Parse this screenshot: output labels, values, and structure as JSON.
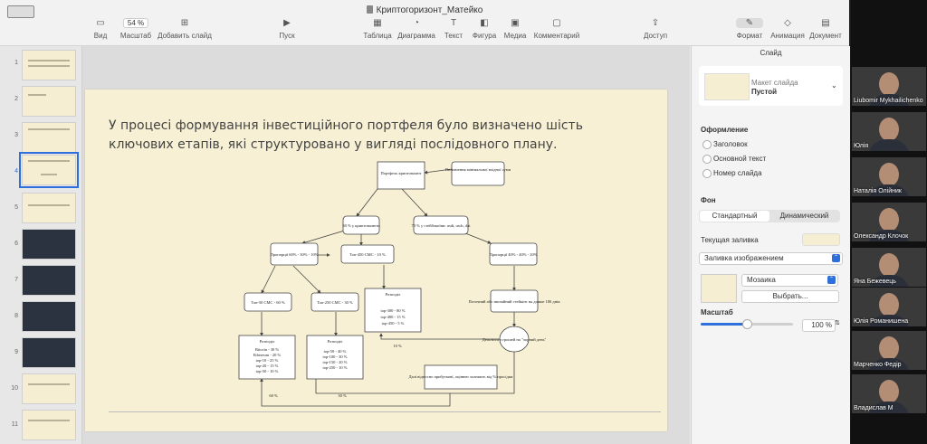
{
  "window": {
    "title": "Криптогоризонт_Матейко"
  },
  "toolbar": {
    "view": "Вид",
    "zoom_value": "54 %",
    "zoom_label": "Масштаб",
    "add_slide": "Добавить слайд",
    "play": "Пуск",
    "table": "Таблица",
    "chart": "Диаграмма",
    "text": "Текст",
    "shape": "Фигура",
    "media": "Медиа",
    "comment": "Комментарий",
    "access": "Доступ",
    "format": "Формат",
    "animation": "Анимация",
    "document": "Документ"
  },
  "sidebar": {
    "numbers": [
      "1",
      "2",
      "3",
      "4",
      "5",
      "6",
      "7",
      "8",
      "9",
      "10",
      "11"
    ],
    "selected": "4"
  },
  "slide": {
    "text": "У процесі формування інвестиційного портфеля було визначено шість ключових етапів, які структуровано у вигляді послідовного плану.",
    "flow": {
      "portfolio": "Портфель криптовалют",
      "min_sum": "Визначення мінімальної вхідної суми",
      "crypto30": "30 % у криптовалюти",
      "stable70": "70 % у стейблкоїни: usdt, usdc, dai",
      "prop_left": "Пропорції 60% - 30% - 10%",
      "prop_right": "Пропорції 40% - 40% - 20%",
      "top450": "Топ-450 CMC - 10 %",
      "top50": "Топ-50 CMC - 60 %",
      "top250": "Топ-250 CMC - 30 %",
      "split_title": "Розподіл",
      "split_top": [
        "top-300 - 80 %",
        "top-400 - 15 %",
        "top-450 - 5 %"
      ],
      "split_left": [
        "Bitcoin - 30 %",
        "Ethereum - 20 %",
        "top-10 - 25 %",
        "top-20 - 15 %",
        "top-50 - 10 %"
      ],
      "split_mid": [
        "top-50 - 40 %",
        "top-100 - 30 %",
        "top-150 - 20 %",
        "top-250 - 10 %"
      ],
      "current_pool": "Поточний або звичайний стейкінг на довше 180 днів",
      "black_day": "Депозити з грошей на \"чорний день\"",
      "further": "Далі відносно прибутковї, оцінюю залежить від % просідки",
      "pct10": "10 %",
      "pct60": "60 %",
      "pct30": "30 %"
    }
  },
  "inspector": {
    "tab": "Слайд",
    "layout_label": "Макет слайда",
    "layout_value": "Пустой",
    "design_title": "Оформление",
    "opt_title": "Заголовок",
    "opt_body": "Основной текст",
    "opt_number": "Номер слайда",
    "bg_title": "Фон",
    "bg_standard": "Стандартный",
    "bg_dynamic": "Динамический",
    "fill_label": "Текущая заливка",
    "fill_type": "Заливка изображением",
    "mosaic": "Мозаика",
    "choose": "Выбрать...",
    "scale_title": "Масштаб",
    "scale_value": "100 %",
    "scale_fraction": 0.5,
    "fill_color": "#f6eed2"
  },
  "participants": [
    "Liubomir Mykhailichenko",
    "Юлія",
    "Наталія Олійник",
    "Олександр Клочок",
    "Яна Бежевець",
    "Юлія Романишена",
    "Марченко Федір",
    "Владислав М"
  ]
}
